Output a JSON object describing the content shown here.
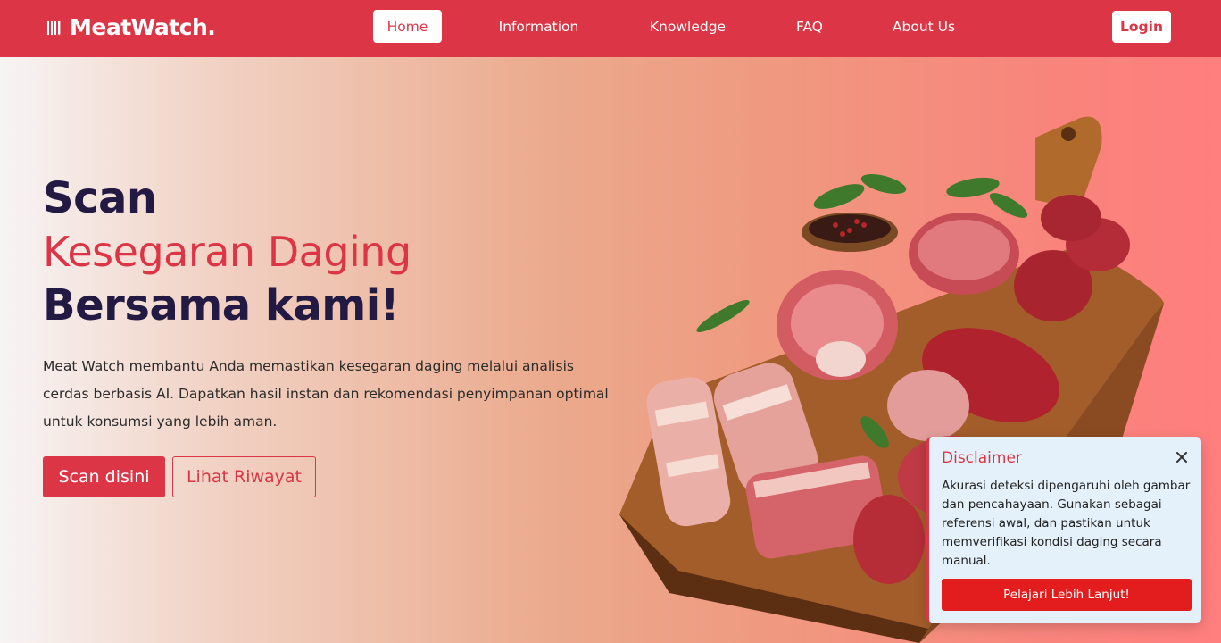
{
  "navbar": {
    "brand": "MeatWatch.",
    "brand_icon": "utensils-icon",
    "links": [
      "Home",
      "Information",
      "Knowledge",
      "FAQ",
      "About Us"
    ],
    "active_link": "Home",
    "login_label": "Login",
    "bg_color": "#dc3545"
  },
  "hero": {
    "title_line1": "Scan",
    "title_line2": "Kesegaran Daging",
    "title_line3": "Bersama kami!",
    "description": "Meat Watch membantu Anda memastikan kesegaran daging melalui analisis cerdas berbasis AI. Dapatkan hasil instan dan rekomendasi penyimpanan optimal untuk konsumsi yang lebih aman.",
    "scan_button": "Scan disini",
    "history_button": "Lihat Riwayat",
    "image": "raw-meat-cutting-board-illustration",
    "accent_color": "#dc3545",
    "title_color": "#221a42"
  },
  "disclaimer": {
    "title": "Disclaimer",
    "close_icon": "close-icon",
    "body": "Akurasi deteksi dipengaruhi oleh gambar dan pencahayaan. Gunakan sebagai referensi awal, dan pastikan untuk memverifikasi kondisi daging secara manual.",
    "button": "Pelajari Lebih Lanjut!",
    "bg_color": "#e4f0fa"
  }
}
